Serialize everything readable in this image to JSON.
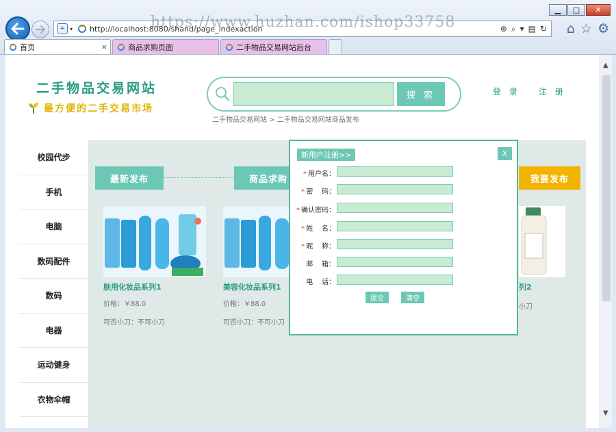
{
  "browser": {
    "url": "http://localhost:8080/shand/page_indexaction",
    "watermark": "https://www.huzhan.com/ishop33758",
    "tabs": [
      {
        "label": "首页",
        "close": "×"
      },
      {
        "label": "商品求购页面"
      },
      {
        "label": "二手物品交易网站后台"
      }
    ]
  },
  "header": {
    "site_title": "二手物品交易网站",
    "slogan": "最方便的二手交易市场",
    "search_button": "搜 索",
    "search_value": "",
    "login": "登 录",
    "register": "注 册",
    "breadcrumb": "二手物品交易网站 > 二手物品交易网站商品发布"
  },
  "sidebar": {
    "items": [
      {
        "label": "校园代步"
      },
      {
        "label": "手机"
      },
      {
        "label": "电脑"
      },
      {
        "label": "数码配件"
      },
      {
        "label": "数码"
      },
      {
        "label": "电器"
      },
      {
        "label": "运动健身"
      },
      {
        "label": "衣物伞帽"
      }
    ]
  },
  "sections": {
    "latest": "最新发布",
    "wanted": "商品求购",
    "mine": "我要发布"
  },
  "products": [
    {
      "name": "肤用化妆品系列1",
      "price": "价格：￥88.0",
      "bargain": "可否小刀：不可小刀"
    },
    {
      "name": "美容化妆品系列1",
      "price": "价格：￥88.0",
      "bargain": "可否小刀：不可小刀"
    },
    {
      "name": "列2",
      "bargain": "小刀"
    }
  ],
  "modal": {
    "tab": "新用户注册>>",
    "close": "X",
    "fields": [
      {
        "label": "用户名：",
        "required": "*",
        "value": ""
      },
      {
        "label": "密    码：",
        "required": "*",
        "value": ""
      },
      {
        "label": "确认密码：",
        "required": "*",
        "value": ""
      },
      {
        "label": "姓    名：",
        "required": "*",
        "value": ""
      },
      {
        "label": "昵    称：",
        "required": "*",
        "value": ""
      },
      {
        "label": "邮    箱：",
        "required": "",
        "value": ""
      },
      {
        "label": "电    话：",
        "required": "",
        "value": ""
      }
    ],
    "submit": "提交",
    "clear": "清空"
  },
  "colors": {
    "accent": "#6cc8b4",
    "title": "#2a9a83",
    "slogan": "#e0b400",
    "input_fill": "#c8ebd2",
    "publish_button": "#f3b400"
  }
}
